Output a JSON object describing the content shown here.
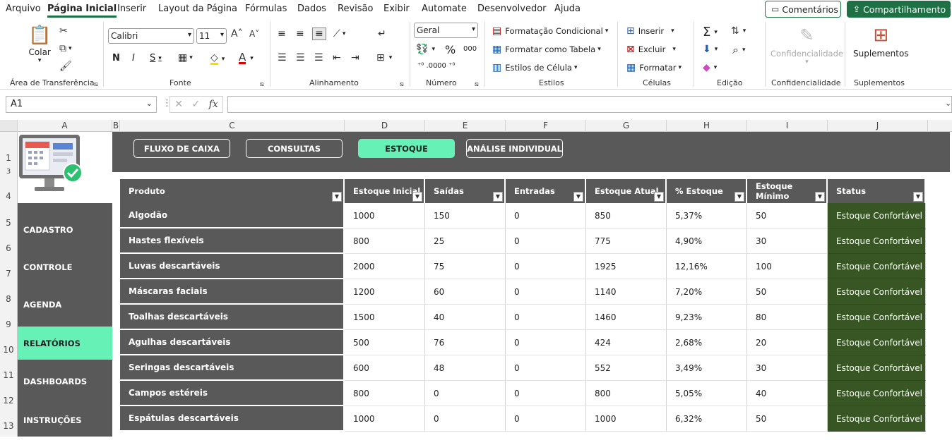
{
  "menu": {
    "tabs": [
      "Arquivo",
      "Página Inicial",
      "Inserir",
      "Layout da Página",
      "Fórmulas",
      "Dados",
      "Revisão",
      "Exibir",
      "Automate",
      "Desenvolvedor",
      "Ajuda"
    ],
    "active_tab": "Página Inicial",
    "comments_label": "Comentários",
    "share_label": "Compartilhamento"
  },
  "ribbon": {
    "paste_label": "Colar",
    "groups": [
      "Área de Transferência",
      "Fonte",
      "Alinhamento",
      "Número",
      "Estilos",
      "Células",
      "Edição",
      "Confidencialidade",
      "Suplementos"
    ],
    "font_name": "Calibri",
    "font_size": "11",
    "number_format": "Geral",
    "styles": [
      "Formatação Condicional",
      "Formatar como Tabela",
      "Estilos de Célula"
    ],
    "cells": [
      "Inserir",
      "Excluir",
      "Formatar"
    ],
    "sensitivity_label": "Confidencialidade",
    "addins_label": "Suplementos"
  },
  "formula_bar": {
    "name_box": "A1",
    "formula": ""
  },
  "columns": [
    "A",
    "B",
    "C",
    "D",
    "E",
    "F",
    "G",
    "H",
    "I",
    "J"
  ],
  "rows": [
    "1",
    "3",
    "4",
    "5",
    "6",
    "7",
    "8",
    "9",
    "10",
    "11",
    "12",
    "13"
  ],
  "nav_buttons": [
    {
      "label": "FLUXO DE CAIXA",
      "active": false
    },
    {
      "label": "CONSULTAS",
      "active": false
    },
    {
      "label": "ESTOQUE",
      "active": true
    },
    {
      "label": "ANÁLISE INDIVIDUAL",
      "active": false
    }
  ],
  "sidebar": [
    {
      "label": "CADASTRO",
      "active": false
    },
    {
      "label": "CONTROLE",
      "active": false
    },
    {
      "label": "AGENDA",
      "active": false
    },
    {
      "label": "RELATÓRIOS",
      "active": true
    },
    {
      "label": "DASHBOARDS",
      "active": false
    },
    {
      "label": "INSTRUÇÕES",
      "active": false
    }
  ],
  "table": {
    "headers": [
      "Produto",
      "Estoque Inicial",
      "Saídas",
      "Entradas",
      "Estoque Atual",
      "% Estoque",
      "Estoque Mínimo",
      "Status"
    ],
    "rows": [
      [
        "Algodão",
        "1000",
        "150",
        "0",
        "850",
        "5,37%",
        "50",
        "Estoque Confortável"
      ],
      [
        "Hastes flexíveis",
        "800",
        "25",
        "0",
        "775",
        "4,90%",
        "30",
        "Estoque Confortável"
      ],
      [
        "Luvas descartáveis",
        "2000",
        "75",
        "0",
        "1925",
        "12,16%",
        "100",
        "Estoque Confortável"
      ],
      [
        "Máscaras faciais",
        "1200",
        "60",
        "0",
        "1140",
        "7,20%",
        "50",
        "Estoque Confortável"
      ],
      [
        "Toalhas descartáveis",
        "1500",
        "40",
        "0",
        "1460",
        "9,23%",
        "80",
        "Estoque Confortável"
      ],
      [
        "Agulhas descartáveis",
        "500",
        "76",
        "0",
        "424",
        "2,68%",
        "20",
        "Estoque Confortável"
      ],
      [
        "Seringas descartáveis",
        "600",
        "48",
        "0",
        "552",
        "3,49%",
        "30",
        "Estoque Confortável"
      ],
      [
        "Campos estéreis",
        "800",
        "0",
        "0",
        "800",
        "5,05%",
        "40",
        "Estoque Confortável"
      ],
      [
        "Espátulas descartáveis",
        "1000",
        "0",
        "0",
        "1000",
        "6,32%",
        "50",
        "Estoque Confortável"
      ]
    ]
  },
  "colors": {
    "accent": "#66f2b7",
    "dark": "#595959",
    "status": "#375623",
    "excel_green": "#1e7145"
  }
}
